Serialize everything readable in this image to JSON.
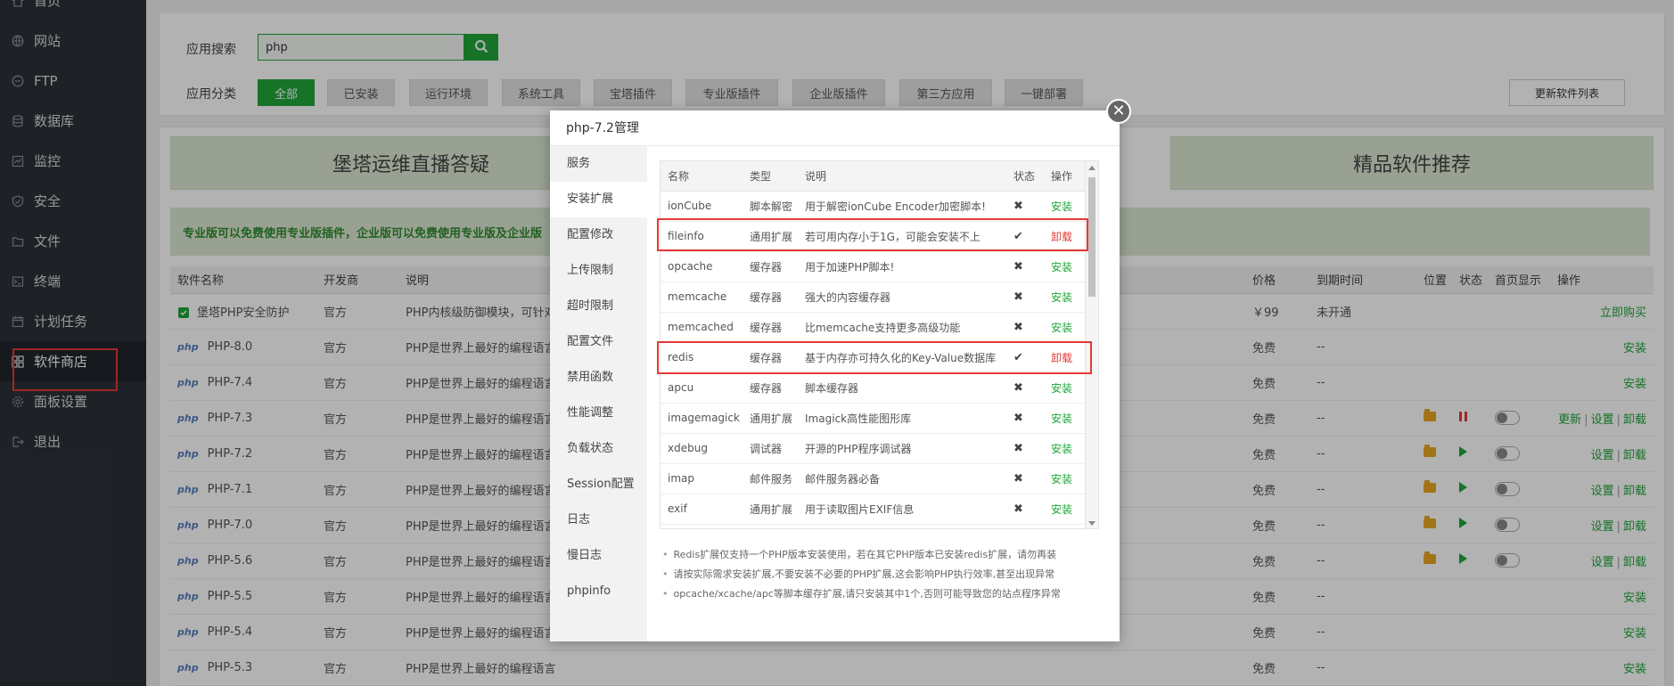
{
  "sidebar": {
    "items": [
      {
        "label": "首页",
        "icon": "home-icon"
      },
      {
        "label": "网站",
        "icon": "globe-icon"
      },
      {
        "label": "FTP",
        "icon": "ftp-icon"
      },
      {
        "label": "数据库",
        "icon": "database-icon"
      },
      {
        "label": "监控",
        "icon": "monitor-icon"
      },
      {
        "label": "安全",
        "icon": "shield-icon"
      },
      {
        "label": "文件",
        "icon": "folder-icon"
      },
      {
        "label": "终端",
        "icon": "terminal-icon"
      },
      {
        "label": "计划任务",
        "icon": "calendar-icon"
      },
      {
        "label": "软件商店",
        "icon": "grid-icon"
      },
      {
        "label": "面板设置",
        "icon": "gear-icon"
      },
      {
        "label": "退出",
        "icon": "logout-icon"
      }
    ]
  },
  "search": {
    "label": "应用搜索",
    "value": "php"
  },
  "categories": {
    "label": "应用分类",
    "items": [
      "全部",
      "已安装",
      "运行环境",
      "系统工具",
      "宝塔插件",
      "专业版插件",
      "企业版插件",
      "第三方应用",
      "一键部署"
    ]
  },
  "update_button": "更新软件列表",
  "promos": {
    "left": "堡塔运维直播答疑",
    "right": "精品软件推荐"
  },
  "notice": "专业版可以免费使用专业版插件，企业版可以免费使用专业版及企业版",
  "software_table": {
    "headers": {
      "name": "软件名称",
      "developer": "开发商",
      "desc": "说明",
      "price": "价格",
      "expire": "到期时间",
      "location": "位置",
      "status": "状态",
      "homepage": "首页显示",
      "ops": "操作"
    },
    "badge": "php",
    "rows": [
      {
        "name": "堡塔PHP安全防护",
        "dev": "官方",
        "desc": "PHP内核级防御模块，可针对",
        "price": "￥99",
        "expire": "未开通",
        "ops": [
          "立即购买"
        ]
      },
      {
        "name": "PHP-8.0",
        "dev": "官方",
        "desc": "PHP是世界上最好的编程语言",
        "price": "免费",
        "expire": "--",
        "ops": [
          "安装"
        ]
      },
      {
        "name": "PHP-7.4",
        "dev": "官方",
        "desc": "PHP是世界上最好的编程语言",
        "price": "免费",
        "expire": "--",
        "ops": [
          "安装"
        ]
      },
      {
        "name": "PHP-7.3",
        "dev": "官方",
        "desc": "PHP是世界上最好的编程语言",
        "price": "免费",
        "expire": "--",
        "ops": [
          "更新",
          "设置",
          "卸载"
        ]
      },
      {
        "name": "PHP-7.2",
        "dev": "官方",
        "desc": "PHP是世界上最好的编程语言",
        "price": "免费",
        "expire": "--",
        "ops": [
          "设置",
          "卸载"
        ]
      },
      {
        "name": "PHP-7.1",
        "dev": "官方",
        "desc": "PHP是世界上最好的编程语言",
        "price": "免费",
        "expire": "--",
        "ops": [
          "设置",
          "卸载"
        ]
      },
      {
        "name": "PHP-7.0",
        "dev": "官方",
        "desc": "PHP是世界上最好的编程语言",
        "price": "免费",
        "expire": "--",
        "ops": [
          "设置",
          "卸载"
        ]
      },
      {
        "name": "PHP-5.6",
        "dev": "官方",
        "desc": "PHP是世界上最好的编程语言",
        "price": "免费",
        "expire": "--",
        "ops": [
          "设置",
          "卸载"
        ]
      },
      {
        "name": "PHP-5.5",
        "dev": "官方",
        "desc": "PHP是世界上最好的编程语言",
        "price": "免费",
        "expire": "--",
        "ops": [
          "安装"
        ]
      },
      {
        "name": "PHP-5.4",
        "dev": "官方",
        "desc": "PHP是世界上最好的编程语言",
        "price": "免费",
        "expire": "--",
        "ops": [
          "安装"
        ]
      },
      {
        "name": "PHP-5.3",
        "dev": "官方",
        "desc": "PHP是世界上最好的编程语言",
        "price": "免费",
        "expire": "--",
        "ops": [
          "安装"
        ]
      }
    ]
  },
  "modal": {
    "title": "php-7.2管理",
    "nav": [
      "服务",
      "安装扩展",
      "配置修改",
      "上传限制",
      "超时限制",
      "配置文件",
      "禁用函数",
      "性能调整",
      "负载状态",
      "Session配置",
      "日志",
      "慢日志",
      "phpinfo"
    ],
    "ext_headers": {
      "name": "名称",
      "type": "类型",
      "desc": "说明",
      "status": "状态",
      "action": "操作"
    },
    "extensions": [
      {
        "name": "ionCube",
        "type": "脚本解密",
        "desc": "用于解密ionCube Encoder加密脚本!",
        "status": "✖",
        "action": "安装"
      },
      {
        "name": "fileinfo",
        "type": "通用扩展",
        "desc": "若可用内存小于1G，可能会安装不上",
        "status": "✔",
        "action": "卸载"
      },
      {
        "name": "opcache",
        "type": "缓存器",
        "desc": "用于加速PHP脚本!",
        "status": "✖",
        "action": "安装"
      },
      {
        "name": "memcache",
        "type": "缓存器",
        "desc": "强大的内容缓存器",
        "status": "✖",
        "action": "安装"
      },
      {
        "name": "memcached",
        "type": "缓存器",
        "desc": "比memcache支持更多高级功能",
        "status": "✖",
        "action": "安装"
      },
      {
        "name": "redis",
        "type": "缓存器",
        "desc": "基于内存亦可持久化的Key-Value数据库",
        "status": "✔",
        "action": "卸载"
      },
      {
        "name": "apcu",
        "type": "缓存器",
        "desc": "脚本缓存器",
        "status": "✖",
        "action": "安装"
      },
      {
        "name": "imagemagick",
        "type": "通用扩展",
        "desc": "Imagick高性能图形库",
        "status": "✖",
        "action": "安装"
      },
      {
        "name": "xdebug",
        "type": "调试器",
        "desc": "开源的PHP程序调试器",
        "status": "✖",
        "action": "安装"
      },
      {
        "name": "imap",
        "type": "邮件服务",
        "desc": "邮件服务器必备",
        "status": "✖",
        "action": "安装"
      },
      {
        "name": "exif",
        "type": "通用扩展",
        "desc": "用于读取图片EXIF信息",
        "status": "✖",
        "action": "安装"
      }
    ],
    "notes": [
      "Redis扩展仅支持一个PHP版本安装使用，若在其它PHP版本已安装redis扩展，请勿再装",
      "请按实际需求安装扩展,不要安装不必要的PHP扩展,这会影响PHP执行效率,甚至出现异常",
      "opcache/xcache/apc等脚本缓存扩展,请只安装其中1个,否则可能导致您的站点程序异常"
    ]
  }
}
